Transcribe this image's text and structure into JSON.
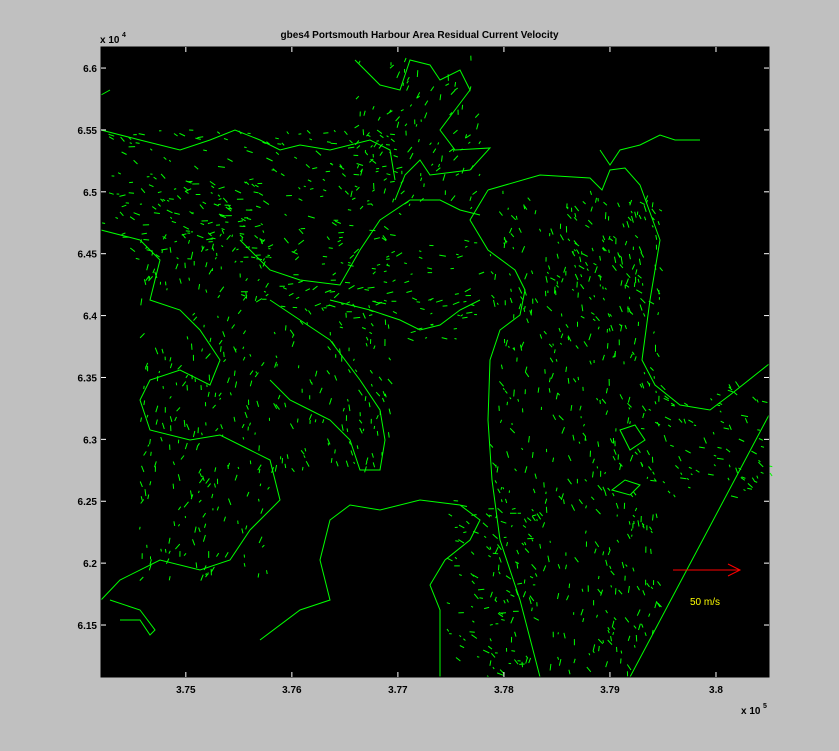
{
  "title": "gbes4 Portsmouth Harbour Area Residual  Current Velocity",
  "chart_data": {
    "type": "vector-field",
    "title": "gbes4 Portsmouth Harbour Area Residual  Current Velocity",
    "xlabel": "",
    "ylabel": "",
    "x_multiplier_label": "x 10",
    "x_multiplier_exp": "5",
    "y_multiplier_label": "x 10",
    "y_multiplier_exp": "4",
    "xlim": [
      3.742,
      3.805
    ],
    "ylim": [
      6.108,
      6.617
    ],
    "xticks": [
      3.75,
      3.76,
      3.77,
      3.78,
      3.79,
      3.8
    ],
    "xtick_labels": [
      "3.75",
      "3.76",
      "3.77",
      "3.78",
      "3.79",
      "3.8"
    ],
    "yticks": [
      6.15,
      6.2,
      6.25,
      6.3,
      6.35,
      6.4,
      6.45,
      6.5,
      6.55,
      6.6
    ],
    "ytick_labels": [
      "6.15",
      "6.2",
      "6.25",
      "6.3",
      "6.35",
      "6.4",
      "6.45",
      "6.5",
      "6.55",
      "6.6"
    ],
    "grid": false,
    "background": "#000000",
    "vector_color": "#00ff00",
    "scale_arrow": {
      "label": "50  m/s",
      "arrow_color": "#ff0000",
      "label_color": "#ffff00",
      "value": 50
    }
  },
  "colors": {
    "figure_bg": "#c0c0c0",
    "axes_bg": "#000000",
    "vectors": "#00ff00"
  }
}
